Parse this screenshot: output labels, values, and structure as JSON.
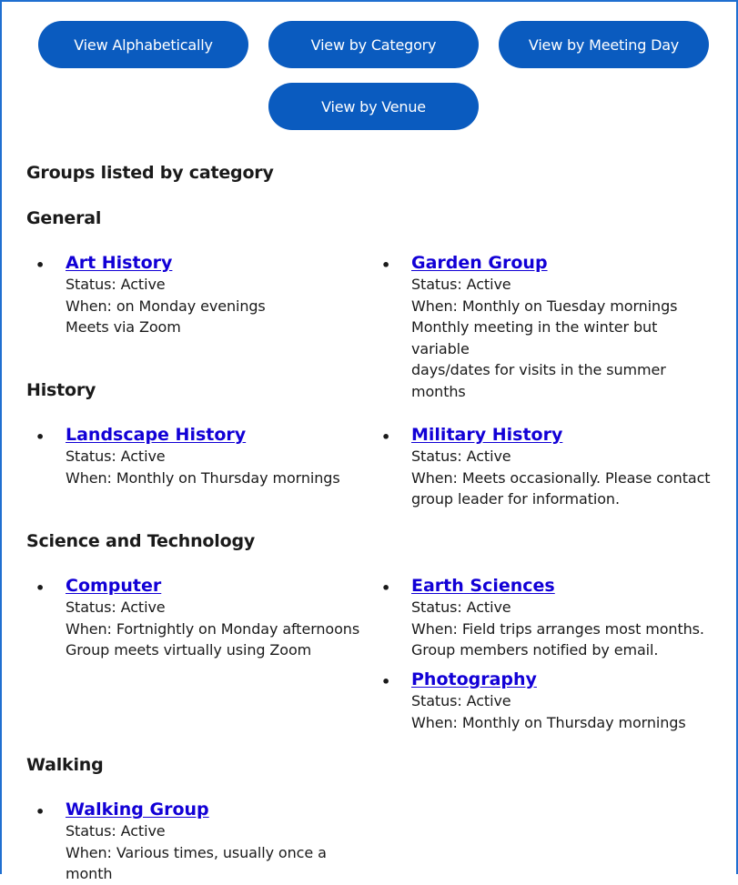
{
  "buttons": {
    "alphabetical": "View Alphabetically",
    "category": "View by Category",
    "meeting_day": "View by Meeting Day",
    "venue": "View by Venue"
  },
  "page_heading": "Groups listed by category",
  "categories": [
    {
      "name": "General",
      "groups": [
        {
          "name": "Art History",
          "status": "Status: Active",
          "when": "When: on Monday evenings",
          "notes": [
            "Meets via Zoom"
          ]
        },
        {
          "name": "Garden Group",
          "status": "Status: Active",
          "when": "When: Monthly on Tuesday mornings",
          "notes": [
            "Monthly meeting in the winter but variable",
            "days/dates for visits in the summer months"
          ]
        }
      ]
    },
    {
      "name": "History",
      "groups": [
        {
          "name": "Landscape History",
          "status": "Status: Active",
          "when": "When: Monthly on Thursday mornings",
          "notes": []
        },
        {
          "name": "Military History",
          "status": "Status: Active",
          "when": "When: Meets occasionally. Please contact",
          "notes": [
            "group leader for information."
          ]
        }
      ]
    },
    {
      "name": "Science and Technology",
      "groups": [
        {
          "name": "Computer",
          "status": "Status: Active",
          "when": "When: Fortnightly on Monday afternoons",
          "notes": [
            "Group meets virtually using Zoom"
          ]
        },
        {
          "name": "Earth Sciences",
          "status": "Status: Active",
          "when": "When: Field trips arranges most months.",
          "notes": [
            "Group members notified by email."
          ]
        },
        {
          "name": "Photography",
          "status": "Status: Active",
          "when": "When: Monthly on Thursday mornings",
          "notes": []
        }
      ]
    },
    {
      "name": "Walking",
      "groups": [
        {
          "name": "Walking Group",
          "status": "Status: Active",
          "when": "When: Various times, usually once a month",
          "notes": []
        }
      ]
    }
  ]
}
